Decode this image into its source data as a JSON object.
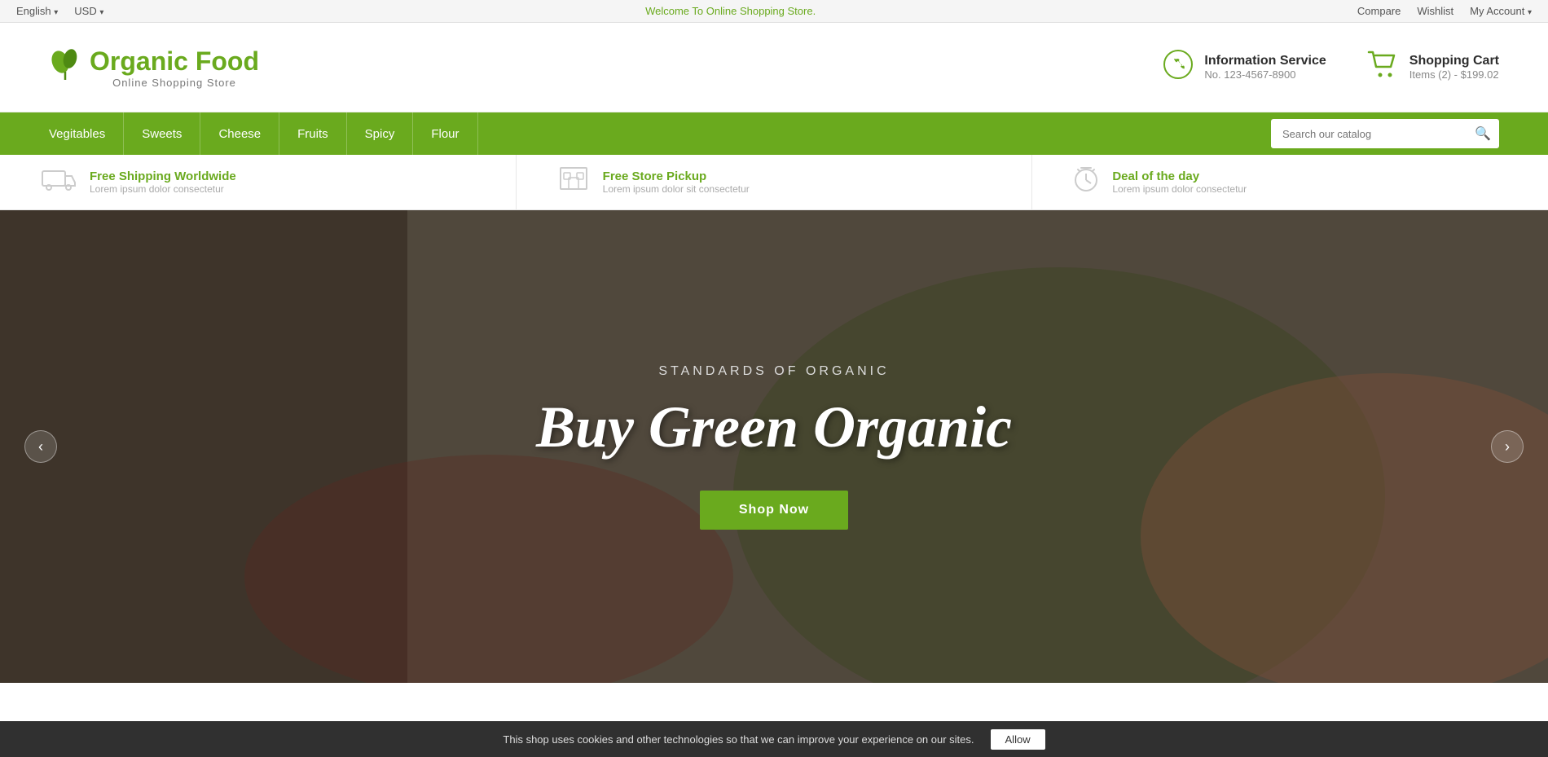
{
  "topbar": {
    "language": "English",
    "currency": "USD",
    "welcome": "Welcome To ",
    "welcome_link": "Online Shopping Store.",
    "compare": "Compare",
    "wishlist": "Wishlist",
    "my_account": "My Account"
  },
  "header": {
    "logo_brand_prefix": "Organic",
    "logo_brand_suffix": " Food",
    "logo_subtitle": "Online Shopping Store",
    "info_label": "Information Service",
    "info_number": "No. 123-4567-8900",
    "cart_label": "Shopping Cart",
    "cart_items": "Items (2) - $199.02"
  },
  "navbar": {
    "items": [
      {
        "label": "Vegitables"
      },
      {
        "label": "Sweets"
      },
      {
        "label": "Cheese"
      },
      {
        "label": "Fruits"
      },
      {
        "label": "Spicy"
      },
      {
        "label": "Flour"
      }
    ],
    "search_placeholder": "Search our catalog"
  },
  "features": [
    {
      "title": "Free Shipping Worldwide",
      "desc": "Lorem ipsum dolor consectetur"
    },
    {
      "title": "Free Store Pickup",
      "desc": "Lorem ipsum dolor sit consectetur"
    },
    {
      "title": "Deal of the day",
      "desc": "Lorem ipsum dolor consectetur"
    }
  ],
  "hero": {
    "subtitle": "STANDARDS OF ORGANIC",
    "title": "Buy Green Organic",
    "btn_label": "Shop Now"
  },
  "cookie": {
    "message": "This shop uses cookies and other technologies so that we can improve your experience on our sites.",
    "allow_label": "Allow"
  }
}
